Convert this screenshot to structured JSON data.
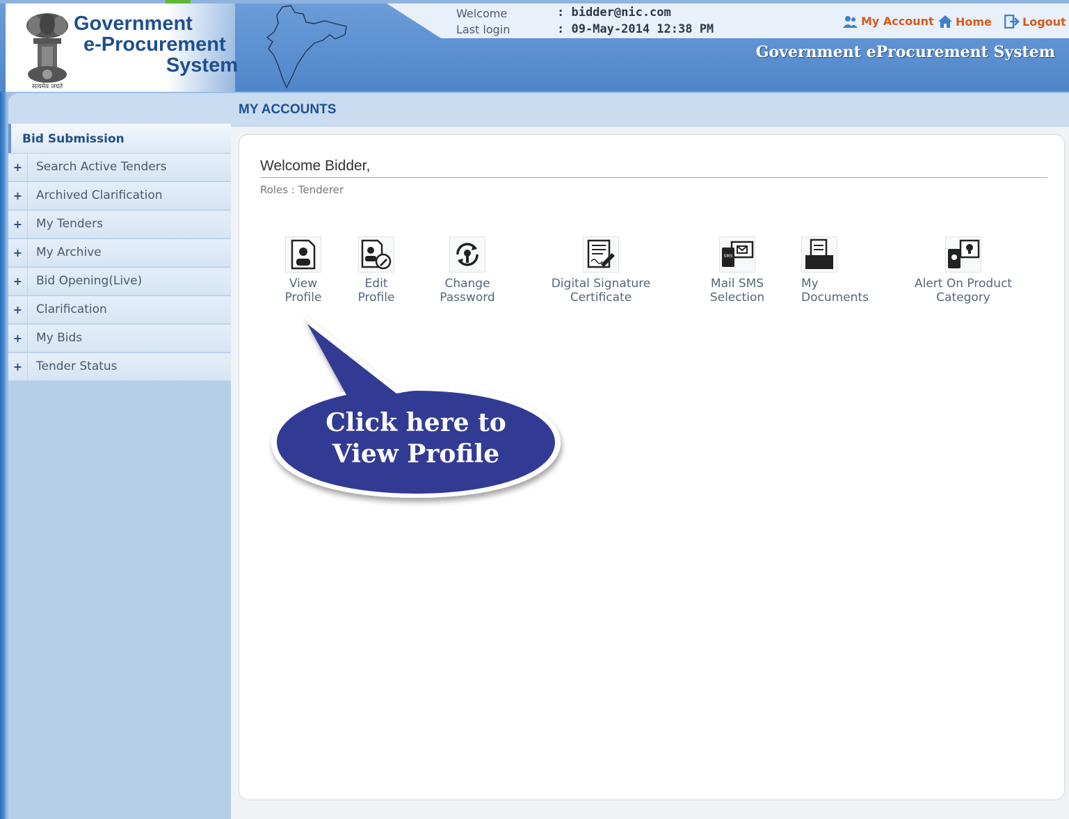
{
  "header": {
    "logo_line1": "Government",
    "logo_line2": "e-Procurement",
    "logo_line3": "System",
    "emblem_caption": "सत्यमेव जयते",
    "welcome_label": "Welcome",
    "welcome_value": ": bidder@nic.com",
    "last_login_label": "Last login",
    "last_login_value": ": 09-May-2014 12:38 PM",
    "my_account": "My Account",
    "home": "Home",
    "logout": "Logout",
    "system_title": "Government eProcurement System"
  },
  "sidebar": {
    "section_title": "Bid Submission",
    "items": [
      {
        "label": "Search Active Tenders"
      },
      {
        "label": "Archived Clarification"
      },
      {
        "label": "My Tenders"
      },
      {
        "label": "My Archive"
      },
      {
        "label": "Bid Opening(Live)"
      },
      {
        "label": "Clarification"
      },
      {
        "label": "My Bids"
      },
      {
        "label": "Tender Status"
      }
    ]
  },
  "main": {
    "title": "MY ACCOUNTS",
    "welcome": "Welcome Bidder,",
    "roles": "Roles : Tenderer",
    "tiles": [
      {
        "label": "View\nProfile",
        "icon": "view-profile-icon"
      },
      {
        "label": "Edit\nProfile",
        "icon": "edit-profile-icon"
      },
      {
        "label": "Change\nPassword",
        "icon": "change-password-icon"
      },
      {
        "label": "Digital Signature\nCertificate",
        "icon": "digital-signature-icon"
      },
      {
        "label": "Mail SMS\nSelection",
        "icon": "mail-sms-icon"
      },
      {
        "label": "My\nDocuments",
        "icon": "documents-icon"
      },
      {
        "label": "Alert On Product\nCategory",
        "icon": "alert-icon"
      }
    ]
  },
  "callout": {
    "line1": "Click here to",
    "line2": "View Profile",
    "color": "#333a94"
  },
  "colors": {
    "accent": "#1f4f8f",
    "link": "#d85a1a"
  }
}
